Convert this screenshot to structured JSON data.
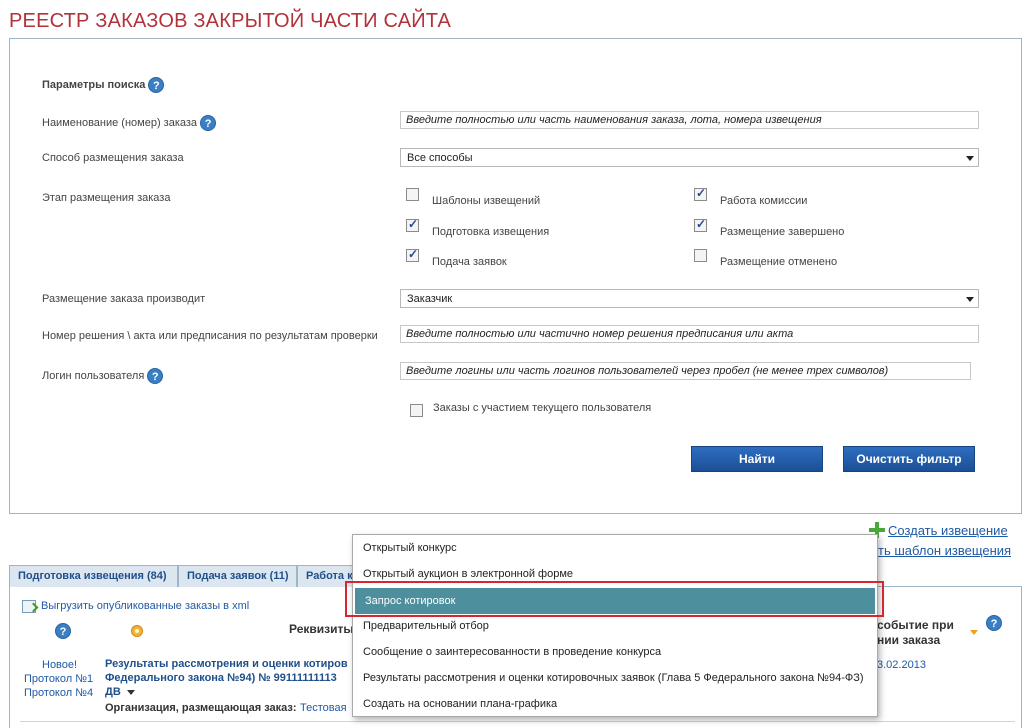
{
  "page": {
    "title": "РЕЕСТР ЗАКАЗОВ ЗАКРЫТОЙ ЧАСТИ САЙТА"
  },
  "search": {
    "header": "Параметры поиска",
    "name_label": "Наименование (номер) заказа",
    "name_placeholder": "Введите полностью или часть наименования заказа, лота, номера извещения",
    "method_label": "Способ размещения заказа",
    "method_value": "Все способы",
    "stage_label": "Этап размещения заказа",
    "stages": [
      {
        "label": "Шаблоны извещений",
        "checked": false
      },
      {
        "label": "Работа комиссии",
        "checked": true
      },
      {
        "label": "Подготовка извещения",
        "checked": true
      },
      {
        "label": "Размещение завершено",
        "checked": true
      },
      {
        "label": "Подача заявок",
        "checked": true
      },
      {
        "label": "Размещение отменено",
        "checked": false
      }
    ],
    "placer_label": "Размещение заказа производит",
    "placer_value": "Заказчик",
    "decision_label": "Номер решения \\ акта или предписания по результатам проверки",
    "decision_placeholder": "Введите полностью или частично номер решения предписания или акта",
    "login_label": "Логин пользователя",
    "login_placeholder": "Введите логины или часть логинов пользователей через пробел (не менее трех символов)",
    "current_user_label": "Заказы с участием текущего пользователя",
    "find_button": "Найти",
    "clear_button": "Очистить фильтр"
  },
  "links": {
    "create_notice": "Создать извещение",
    "create_template_partial": "ть шаблон извещения"
  },
  "tabs": [
    {
      "label": "Подготовка извещения (84)"
    },
    {
      "label": "Подача заявок (11)"
    },
    {
      "label": "Работа к"
    }
  ],
  "list": {
    "export_label": "Выгрузить опубликованные заказы в xml",
    "col_requisites": "Реквизиты",
    "col_event_line1": "событие при",
    "col_event_line2": "нии заказа",
    "row": {
      "status_new": "Новое!",
      "protocol1": "Протокол №1",
      "protocol4": "Протокол №4",
      "title_line1": "Результаты рассмотрения и оценки котиров",
      "title_line2": "Федерального закона №94)  №  99111111113",
      "title_line3": "ДВ",
      "org_label": "Организация, размещающая заказ:",
      "org_value": "Тестовая",
      "date_partial": "3.02.2013"
    }
  },
  "dropdown": {
    "items": [
      "Открытый конкурс",
      "Открытый аукцион в электронной форме",
      "Запрос котировок",
      "Предварительный отбор",
      "Сообщение о заинтересованности в проведение конкурса",
      "Результаты рассмотрения и оценки котировочных заявок (Глава 5 Федерального закона №94-ФЗ)",
      "Создать на основании плана-графика"
    ],
    "active_index": 2
  },
  "colors": {
    "title_red": "#b3323a",
    "link_blue": "#1f5aa6",
    "button_blue": "#1b4f95",
    "active_item": "#4d8f9c",
    "highlight_red": "#d6262f"
  }
}
